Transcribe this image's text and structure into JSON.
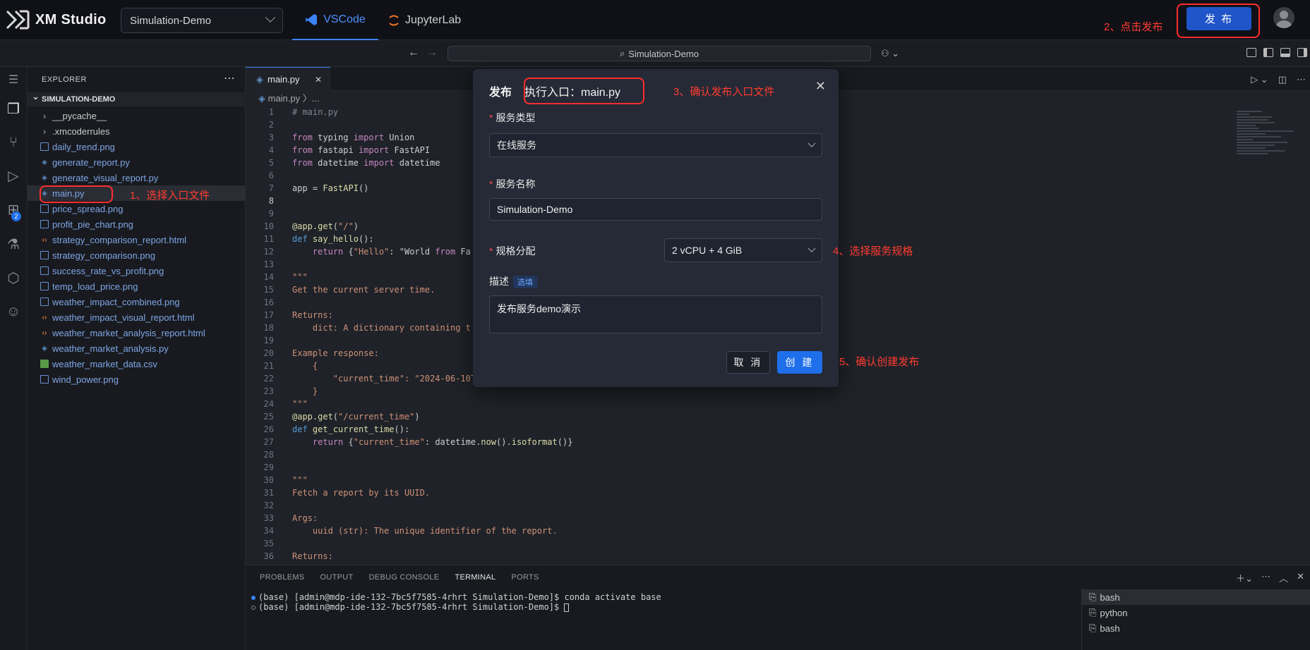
{
  "app": {
    "name": "XM Studio",
    "project": "Simulation-Demo",
    "tabs": [
      {
        "label": "VSCode",
        "active": true
      },
      {
        "label": "JupyterLab",
        "active": false
      }
    ],
    "publish_label": "发 布"
  },
  "vscode": {
    "command_center": "Simulation-Demo",
    "explorer_title": "EXPLORER",
    "folder": "SIMULATION-DEMO",
    "files": [
      {
        "name": "__pycache__",
        "type": "dir"
      },
      {
        "name": ".xmcoderrules",
        "type": "dir"
      },
      {
        "name": "daily_trend.png",
        "type": "png"
      },
      {
        "name": "generate_report.py",
        "type": "py"
      },
      {
        "name": "generate_visual_report.py",
        "type": "py"
      },
      {
        "name": "main.py",
        "type": "py",
        "selected": true
      },
      {
        "name": "price_spread.png",
        "type": "png"
      },
      {
        "name": "profit_pie_chart.png",
        "type": "png"
      },
      {
        "name": "strategy_comparison_report.html",
        "type": "html"
      },
      {
        "name": "strategy_comparison.png",
        "type": "png"
      },
      {
        "name": "success_rate_vs_profit.png",
        "type": "png"
      },
      {
        "name": "temp_load_price.png",
        "type": "png"
      },
      {
        "name": "weather_impact_combined.png",
        "type": "png"
      },
      {
        "name": "weather_impact_visual_report.html",
        "type": "html"
      },
      {
        "name": "weather_market_analysis_report.html",
        "type": "html"
      },
      {
        "name": "weather_market_analysis.py",
        "type": "py"
      },
      {
        "name": "weather_market_data.csv",
        "type": "csv"
      },
      {
        "name": "wind_power.png",
        "type": "png"
      }
    ],
    "editor_tab": "main.py",
    "breadcrumb": "main.py 〉...",
    "extensions_badge": "2",
    "code_lines": [
      "# main.py",
      "",
      "from typing import Union",
      "from fastapi import FastAPI",
      "from datetime import datetime",
      "",
      "app = FastAPI()",
      "",
      "",
      "@app.get(\"/\")",
      "def say_hello():",
      "    return {\"Hello\": \"World from Fa",
      "",
      "\"\"\"",
      "Get the current server time.",
      "",
      "Returns:",
      "    dict: A dictionary containing t",
      "",
      "Example response:",
      "    {",
      "        \"current_time\": \"2024-06-10T",
      "    }",
      "\"\"\"",
      "@app.get(\"/current_time\")",
      "def get_current_time():",
      "    return {\"current_time\": datetime.now().isoformat()}",
      "",
      "",
      "\"\"\"",
      "Fetch a report by its UUID.",
      "",
      "Args:",
      "    uuid (str): The unique identifier of the report.",
      "",
      "Returns:"
    ],
    "current_line": 8,
    "panel_tabs": [
      {
        "label": "PROBLEMS",
        "active": false
      },
      {
        "label": "OUTPUT",
        "active": false
      },
      {
        "label": "DEBUG CONSOLE",
        "active": false
      },
      {
        "label": "TERMINAL",
        "active": true
      },
      {
        "label": "PORTS",
        "active": false
      }
    ],
    "terminal_lines": [
      "(base) [admin@mdp-ide-132-7bc5f7585-4rhrt Simulation-Demo]$ conda activate base",
      "(base) [admin@mdp-ide-132-7bc5f7585-4rhrt Simulation-Demo]$ "
    ],
    "terminals": [
      {
        "label": "bash",
        "selected": true
      },
      {
        "label": "python",
        "selected": false
      },
      {
        "label": "bash",
        "selected": false
      }
    ]
  },
  "modal": {
    "title": "发布",
    "entry": "执行入口：main.py",
    "service_type_label": "服务类型",
    "service_type_value": "在线服务",
    "service_name_label": "服务名称",
    "service_name_value": "Simulation-Demo",
    "spec_label": "规格分配",
    "spec_value": "2 vCPU + 4 GiB",
    "desc_label": "描述",
    "desc_optional": "选填",
    "desc_value": "发布服务demo演示",
    "cancel_label": "取 消",
    "create_label": "创 建"
  },
  "annotations": [
    "1、选择入口文件",
    "2、点击发布",
    "3、确认发布入口文件",
    "4、选择服务规格",
    "5、确认创建发布"
  ],
  "colors": {
    "accent": "#1f6feb",
    "annotation": "#ff3b30"
  }
}
